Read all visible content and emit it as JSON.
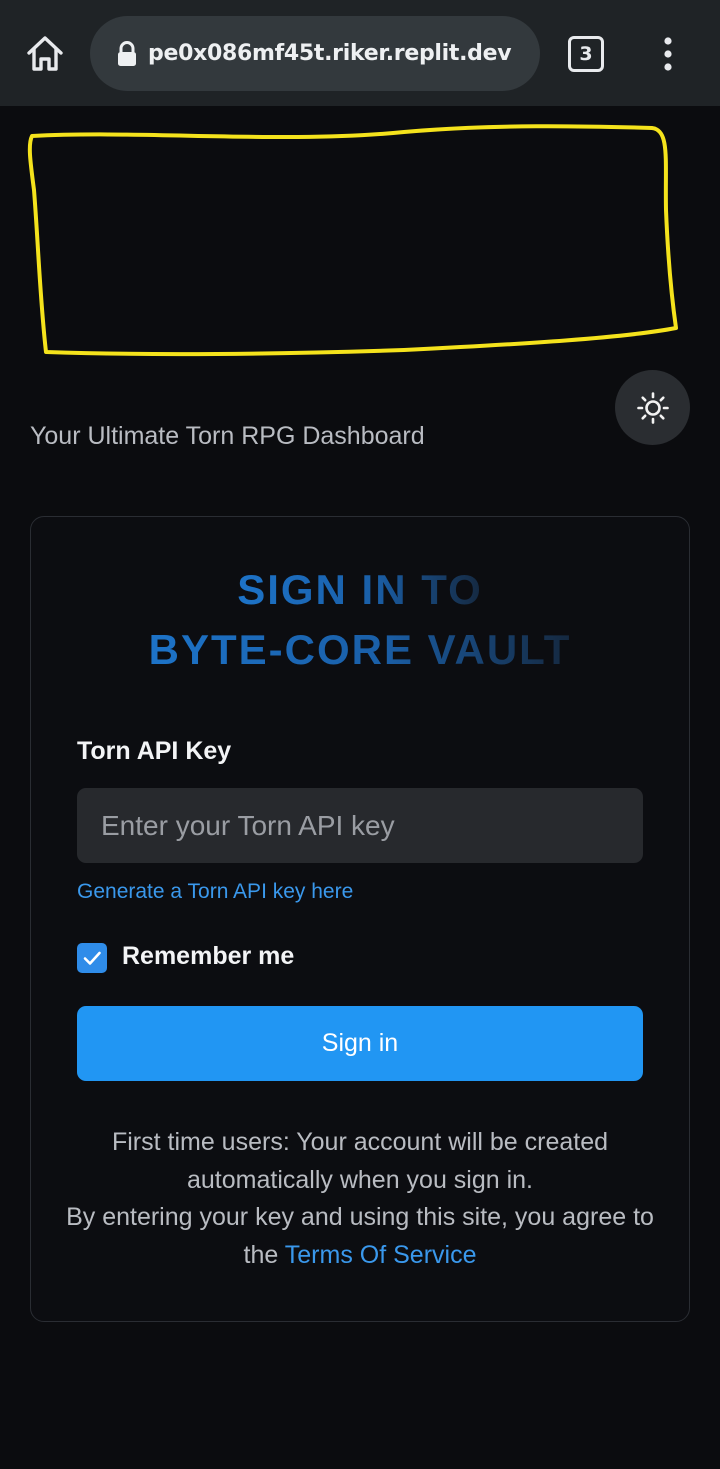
{
  "browser": {
    "url": "pe0x086mf45t.riker.replit.dev",
    "tab_count": "3",
    "icons": [
      "home-icon",
      "lock-icon",
      "overflow-menu-icon"
    ]
  },
  "header": {
    "tagline": "Your Ultimate Torn RPG Dashboard",
    "theme_toggle_icon": "sun-icon"
  },
  "login": {
    "title_line1": "SIGN IN TO",
    "title_line2": "BYTE-CORE VAULT",
    "api_key_label": "Torn API Key",
    "api_key_value": "",
    "api_key_placeholder": "Enter your Torn API key",
    "generate_link": "Generate a Torn API key here",
    "remember_label": "Remember me",
    "remember_checked": true,
    "submit_label": "Sign in",
    "notice_line1": "First time users: Your account will be created automatically when you sign in.",
    "notice_line2": "By entering your key and using this site, you agree to the",
    "tos_link": "Terms Of Service"
  },
  "colors": {
    "background": "#0b0c0f",
    "accent": "#2196f3",
    "link": "#3a98ec",
    "redaction_outline": "#f5e31c"
  }
}
